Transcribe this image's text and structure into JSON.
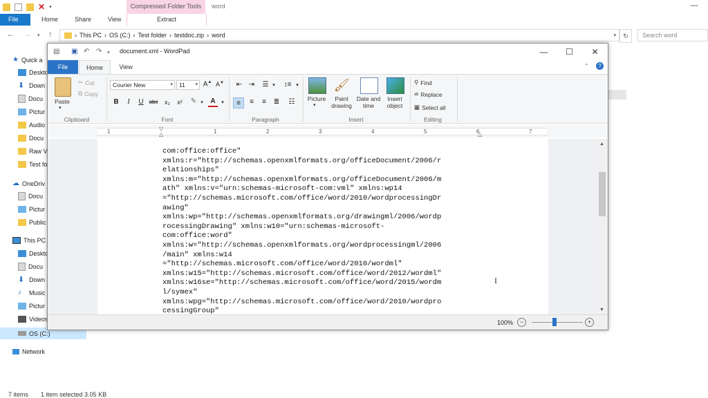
{
  "explorer": {
    "context_group": "Compressed Folder Tools",
    "context_tab": "Extract",
    "title": "word",
    "tabs": [
      "File",
      "Home",
      "Share",
      "View"
    ],
    "breadcrumbs": [
      "This PC",
      "OS (C:)",
      "Test folder",
      "testdoc.zip",
      "word"
    ],
    "search_placeholder": "Search word",
    "nav": {
      "quick_access": "Quick a",
      "qa_items": [
        "Deskto",
        "Down",
        "Docu",
        "Pictur",
        "Audio",
        "Docu",
        "Raw V",
        "Test fo"
      ],
      "onedrive": "OneDriv",
      "od_items": [
        "Docu",
        "Pictur",
        "Public"
      ],
      "this_pc": "This PC",
      "pc_items": [
        "Deskto",
        "Docu",
        "Down",
        "Music",
        "Pictur",
        "Videos",
        "OS (C:)"
      ],
      "network": "Network"
    },
    "status": {
      "items": "7 items",
      "selected": "1 item selected  3.05 KB"
    }
  },
  "wordpad": {
    "title": "document.xml - WordPad",
    "tabs": {
      "file": "File",
      "home": "Home",
      "view": "View"
    },
    "clipboard": {
      "paste": "Paste",
      "cut": "Cut",
      "copy": "Copy",
      "label": "Clipboard"
    },
    "font": {
      "family": "Courier New",
      "size": "11",
      "label": "Font"
    },
    "paragraph": {
      "label": "Paragraph"
    },
    "insert": {
      "picture": "Picture",
      "paint": "Paint drawing",
      "paint1": "Paint",
      "paint2": "drawing",
      "datetime1": "Date and",
      "datetime2": "time",
      "object1": "Insert",
      "object2": "object",
      "label": "Insert"
    },
    "editing": {
      "find": "Find",
      "replace": "Replace",
      "select_all": "Select all",
      "label": "Editing"
    },
    "ruler": [
      "1",
      "1",
      "2",
      "3",
      "4",
      "5",
      "6",
      "7"
    ],
    "document_text": "com:office:office\"\nxmlns:r=\"http://schemas.openxmlformats.org/officeDocument/2006/r\nelationships\"\nxmlns:m=\"http://schemas.openxmlformats.org/officeDocument/2006/m\nath\" xmlns:v=\"urn:schemas-microsoft-com:vml\" xmlns:wp14\n=\"http://schemas.microsoft.com/office/word/2010/wordprocessingDr\nawing\"\nxmlns:wp=\"http://schemas.openxmlformats.org/drawingml/2006/wordp\nrocessingDrawing\" xmlns:w10=\"urn:schemas-microsoft-\ncom:office:word\"\nxmlns:w=\"http://schemas.openxmlformats.org/wordprocessingml/2006\n/main\" xmlns:w14\n=\"http://schemas.microsoft.com/office/word/2010/wordml\"\nxmlns:w15=\"http://schemas.microsoft.com/office/word/2012/wordml\"\nxmlns:w16se=\"http://schemas.microsoft.com/office/word/2015/wordm\nl/symex\"\nxmlns:wpg=\"http://schemas.microsoft.com/office/word/2010/wordpro\ncessingGroup\"",
    "zoom": "100%",
    "zoom_level_percent": 100
  }
}
